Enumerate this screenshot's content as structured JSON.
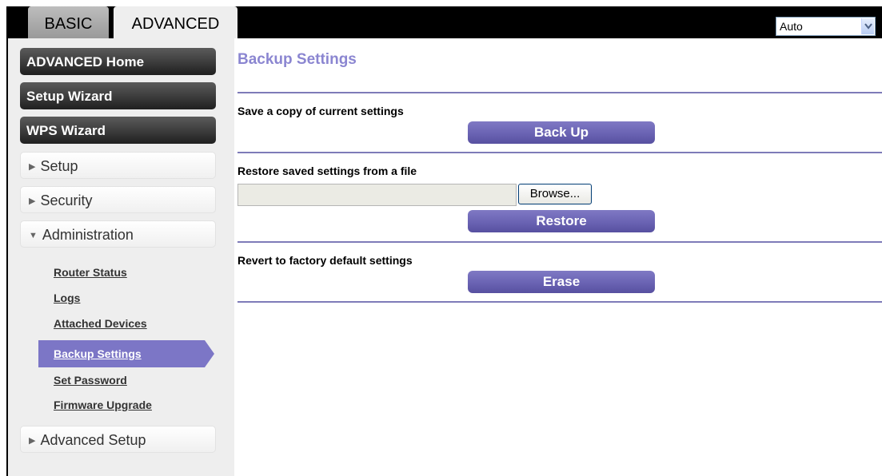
{
  "tabs": {
    "basic": "BASIC",
    "advanced": "ADVANCED"
  },
  "language": {
    "selected": "Auto"
  },
  "sidebar": {
    "advanced_home": "ADVANCED Home",
    "setup_wizard": "Setup Wizard",
    "wps_wizard": "WPS Wizard",
    "setup": "Setup",
    "security": "Security",
    "administration": "Administration",
    "admin_items": {
      "router_status": "Router Status",
      "logs": "Logs",
      "attached_devices": "Attached Devices",
      "backup_settings": "Backup Settings",
      "set_password": "Set Password",
      "firmware_upgrade": "Firmware Upgrade"
    },
    "advanced_setup": "Advanced Setup"
  },
  "main": {
    "title": "Backup Settings",
    "save": {
      "label": "Save a copy of current settings",
      "button": "Back Up"
    },
    "restore": {
      "label": "Restore saved settings from a file",
      "file_value": "",
      "browse": "Browse...",
      "button": "Restore"
    },
    "revert": {
      "label": "Revert to factory default settings",
      "button": "Erase"
    }
  },
  "colors": {
    "accent": "#6a63b3",
    "title": "#8b86d1",
    "divider": "#7e7bb8",
    "dark_nav": "#3e3e3e"
  }
}
